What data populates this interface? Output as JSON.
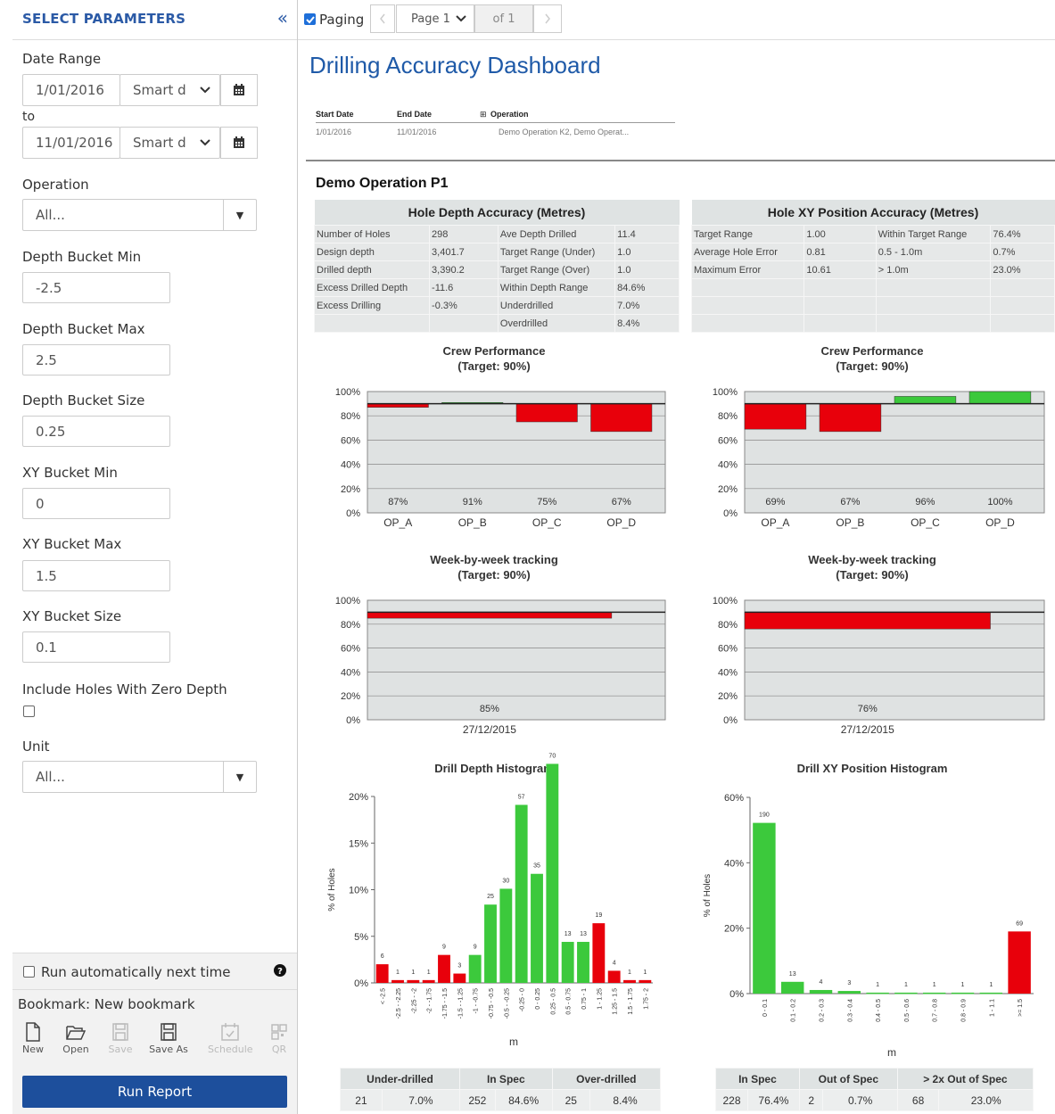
{
  "sidebar": {
    "title": "SELECT PARAMETERS",
    "collapse_icon": "«",
    "date_range_label": "Date Range",
    "start_date": "1/01/2016",
    "start_smart": "Smart d",
    "to_label": "to",
    "end_date": "11/01/2016",
    "end_smart": "Smart d",
    "operation_label": "Operation",
    "operation_value": "All...",
    "depth_min_label": "Depth Bucket Min",
    "depth_min": "-2.5",
    "depth_max_label": "Depth Bucket Max",
    "depth_max": "2.5",
    "depth_size_label": "Depth Bucket Size",
    "depth_size": "0.25",
    "xy_min_label": "XY Bucket Min",
    "xy_min": "0",
    "xy_max_label": "XY Bucket Max",
    "xy_max": "1.5",
    "xy_size_label": "XY Bucket Size",
    "xy_size": "0.1",
    "zero_depth_label": "Include Holes With Zero Depth",
    "unit_label": "Unit",
    "unit_value": "All...",
    "run_auto_label": "Run automatically next time",
    "bookmark_label": "Bookmark: New bookmark",
    "tools": [
      "New",
      "Open",
      "Save",
      "Save As",
      "Schedule",
      "QR"
    ],
    "run_button": "Run Report"
  },
  "toolbar": {
    "paging_label": "Paging",
    "page_value": "Page 1",
    "of_label": "of 1"
  },
  "report": {
    "title": "Drilling Accuracy Dashboard",
    "filter_headers": [
      "Start Date",
      "End Date",
      "Operation"
    ],
    "filter_values": [
      "1/01/2016",
      "11/01/2016",
      "Demo Operation K2, Demo Operat..."
    ],
    "section": "Demo Operation P1",
    "depth_table": {
      "title": "Hole Depth Accuracy (Metres)",
      "rows": [
        [
          "Number of Holes",
          "298",
          "Ave Depth Drilled",
          "11.4"
        ],
        [
          "Design depth",
          "3,401.7",
          "Target Range (Under)",
          "1.0"
        ],
        [
          "Drilled depth",
          "3,390.2",
          "Target Range (Over)",
          "1.0"
        ],
        [
          "Excess Drilled Depth",
          "-11.6",
          "Within Depth Range",
          "84.6%"
        ],
        [
          "Excess Drilling",
          "-0.3%",
          "Underdrilled",
          "7.0%"
        ],
        [
          "",
          "",
          "Overdrilled",
          "8.4%"
        ]
      ]
    },
    "xy_table": {
      "title": "Hole XY Position Accuracy (Metres)",
      "rows": [
        [
          "Target Range",
          "1.00",
          "Within Target Range",
          "76.4%"
        ],
        [
          "Average Hole Error",
          "0.81",
          "0.5 - 1.0m",
          "0.7%"
        ],
        [
          "Maximum Error",
          "10.61",
          "> 1.0m",
          "23.0%"
        ],
        [
          "",
          "",
          "",
          ""
        ],
        [
          "",
          "",
          "",
          ""
        ],
        [
          "",
          "",
          "",
          ""
        ]
      ]
    },
    "depth_under_table": {
      "headers": [
        "Under-drilled",
        "In Spec",
        "Over-drilled"
      ],
      "values": [
        "21",
        "7.0%",
        "252",
        "84.6%",
        "25",
        "8.4%"
      ]
    },
    "xy_under_table": {
      "headers": [
        "In Spec",
        "Out of Spec",
        "> 2x Out of Spec"
      ],
      "values": [
        "228",
        "76.4%",
        "2",
        "0.7%",
        "68",
        "23.0%"
      ]
    }
  },
  "chart_data": [
    {
      "type": "bar",
      "title": "Crew Performance",
      "subtitle": "(Target: 90%)",
      "categories": [
        "OP_A",
        "OP_B",
        "OP_C",
        "OP_D"
      ],
      "values": [
        87,
        91,
        75,
        67
      ],
      "labels": [
        "87%",
        "91%",
        "75%",
        "67%"
      ],
      "target": 90,
      "ylim": [
        0,
        100
      ],
      "yticks": [
        "0%",
        "20%",
        "40%",
        "60%",
        "80%",
        "100%"
      ],
      "colors": {
        "below": "#e8000b",
        "above": "#3cc93c"
      }
    },
    {
      "type": "bar",
      "title": "Crew Performance",
      "subtitle": "(Target: 90%)",
      "categories": [
        "OP_A",
        "OP_B",
        "OP_C",
        "OP_D"
      ],
      "values": [
        69,
        67,
        96,
        100
      ],
      "labels": [
        "69%",
        "67%",
        "96%",
        "100%"
      ],
      "target": 90,
      "ylim": [
        0,
        100
      ],
      "yticks": [
        "0%",
        "20%",
        "40%",
        "60%",
        "80%",
        "100%"
      ],
      "colors": {
        "below": "#e8000b",
        "above": "#3cc93c"
      }
    },
    {
      "type": "bar",
      "title": "Week-by-week tracking",
      "subtitle": "(Target: 90%)",
      "categories": [
        "27/12/2015"
      ],
      "values": [
        85
      ],
      "labels": [
        "85%"
      ],
      "target": 90,
      "ylim": [
        0,
        100
      ],
      "yticks": [
        "0%",
        "20%",
        "40%",
        "60%",
        "80%",
        "100%"
      ],
      "colors": {
        "below": "#e8000b",
        "above": "#3cc93c"
      }
    },
    {
      "type": "bar",
      "title": "Week-by-week tracking",
      "subtitle": "(Target: 90%)",
      "categories": [
        "27/12/2015"
      ],
      "values": [
        76
      ],
      "labels": [
        "76%"
      ],
      "target": 90,
      "ylim": [
        0,
        100
      ],
      "yticks": [
        "0%",
        "20%",
        "40%",
        "60%",
        "80%",
        "100%"
      ],
      "colors": {
        "below": "#e8000b",
        "above": "#3cc93c"
      }
    },
    {
      "type": "bar",
      "title": "Drill Depth Histogram",
      "xlabel": "m",
      "ylabel": "% of Holes",
      "ylim": [
        0,
        20
      ],
      "yticks": [
        "0%",
        "5%",
        "10%",
        "15%",
        "20%"
      ],
      "categories": [
        "< -2.5",
        "-2.5 - -2.25",
        "-2.25 - -2",
        "-2 - -1.75",
        "-1.75 - -1.5",
        "-1.5 - -1.25",
        "-1 - -0.75",
        "-0.75 - -0.5",
        "-0.5 - -0.25",
        "-0.25 - 0",
        "0 - 0.25",
        "0.25 - 0.5",
        "0.5 - 0.75",
        "0.75 - 1",
        "1 - 1.25",
        "1.25 - 1.5",
        "1.5 - 1.75",
        "1.75 - 2"
      ],
      "counts": [
        6,
        1,
        1,
        1,
        9,
        3,
        9,
        25,
        30,
        57,
        35,
        70,
        13,
        13,
        19,
        4,
        1,
        1
      ],
      "values": [
        2.0,
        0.3,
        0.3,
        0.3,
        3.0,
        1.0,
        3.0,
        8.4,
        10.1,
        19.1,
        11.7,
        23.5,
        4.4,
        4.4,
        6.4,
        1.3,
        0.3,
        0.3
      ],
      "in_spec": [
        false,
        false,
        false,
        false,
        false,
        false,
        true,
        true,
        true,
        true,
        true,
        true,
        true,
        true,
        false,
        false,
        false,
        false
      ],
      "colors": {
        "out": "#e8000b",
        "in": "#3cc93c"
      }
    },
    {
      "type": "bar",
      "title": "Drill XY Position Histogram",
      "xlabel": "m",
      "ylabel": "% of Holes",
      "ylim": [
        0,
        60
      ],
      "yticks": [
        "0%",
        "20%",
        "40%",
        "60%"
      ],
      "categories": [
        "0 - 0.1",
        "0.1 - 0.2",
        "0.2 - 0.3",
        "0.3 - 0.4",
        "0.4 - 0.5",
        "0.5 - 0.6",
        "0.7 - 0.8",
        "0.8 - 0.9",
        "1 - 1.1",
        ">= 1.5"
      ],
      "counts": [
        190,
        13,
        4,
        3,
        1,
        1,
        1,
        1,
        1,
        69
      ],
      "values": [
        52.2,
        3.6,
        1.1,
        0.8,
        0.3,
        0.3,
        0.3,
        0.3,
        0.3,
        19.0
      ],
      "in_spec": [
        true,
        true,
        true,
        true,
        true,
        true,
        true,
        true,
        true,
        false
      ],
      "colors": {
        "out": "#e8000b",
        "in": "#3cc93c"
      }
    }
  ]
}
